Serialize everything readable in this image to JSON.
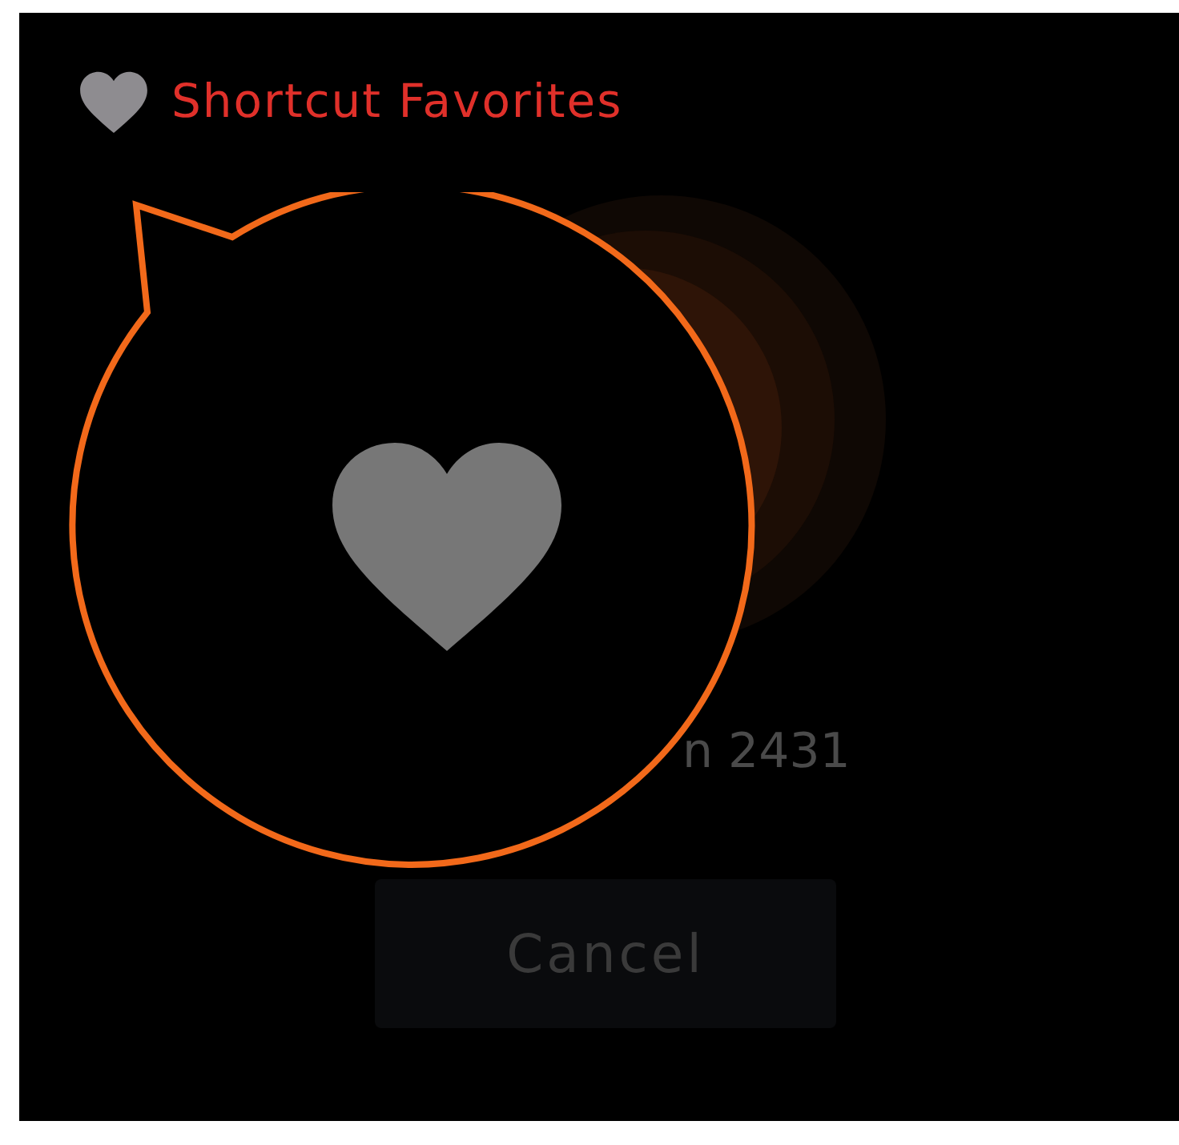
{
  "header": {
    "title": "Shortcut Favorites"
  },
  "reading": "n 2431",
  "cancel_button": {
    "label": "Cancel",
    "disabled": true
  }
}
